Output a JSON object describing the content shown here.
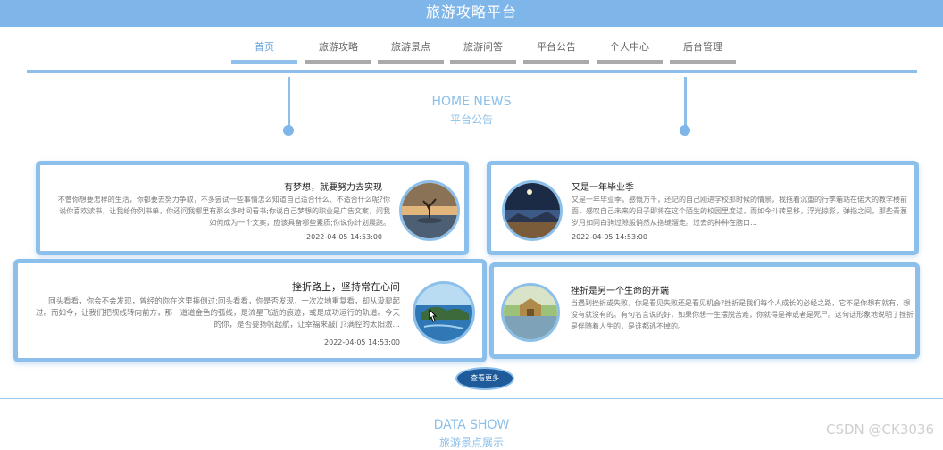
{
  "header": {
    "title": "旅游攻略平台"
  },
  "nav": {
    "items": [
      {
        "label": "首页",
        "active": true
      },
      {
        "label": "旅游攻略",
        "active": false
      },
      {
        "label": "旅游景点",
        "active": false
      },
      {
        "label": "旅游问答",
        "active": false
      },
      {
        "label": "平台公告",
        "active": false
      },
      {
        "label": "个人中心",
        "active": false
      },
      {
        "label": "后台管理",
        "active": false
      }
    ]
  },
  "news_section": {
    "title_en": "HOME NEWS",
    "title_cn": "平台公告"
  },
  "cards": [
    {
      "title": "有梦想，就要努力去实现",
      "body": "不管你想要怎样的生活，你都要去努力争取，不多尝试一些事情怎么知道自己适合什么、不适合什么呢?你说你喜欢读书，让我给你列书单，你还问我哪里有那么多时间看书;你说自己梦想的职业是广告文案，问我如何成为一个文案，应该具备哪些素质;你说你计划晨跑。",
      "date": "2022-04-05 14:53:00",
      "image": "lake-tree-sunset"
    },
    {
      "title": "又是一年毕业季",
      "body": "又是一年毕业季，感慨万千，还记的自己刚进学校那时候的情景，我拖着沉重的行李箱站在偌大的教学楼前面，感叹自己未来的日子即将在这个陌生的校园里度过，而如今斗转星移，浮光掠影，弹指之间，那些青葱岁月如同白驹过隙般悄然从指缝溜走。过去的种种在脑口…",
      "date": "2022-04-05 14:53:00",
      "image": "night-sky-coast"
    },
    {
      "title": "挫折路上，坚持常在心间",
      "body": "回头看看，你会不会发现，曾经的你在这里摔倒过;回头看看，你是否发现，一次次地重复看，却从没爬起过。而如今，让我们把视线转向前方，那一道道金色的弧线，是流星飞逝的痕迹，或是成功运行的轨道。今天的你，是否要扬帆起航，让幸福来敲门?满腔的太阳激…",
      "date": "2022-04-05 14:53:00",
      "image": "island-sea"
    },
    {
      "title": "挫折是另一个生命的开端",
      "body": "当遇到挫折或失败，你是看见失败还是看见机会?挫折是我们每个人成长的必经之路，它不是你想有就有，想没有就没有的。有句名言说的好，如果你想一生摆脱苦难，你就得是神或者是死尸。这句话形象地说明了挫折是伴随着人生的，是谁都逃不掉的。",
      "date": "",
      "image": "lake-temple"
    }
  ],
  "more_button": {
    "label": "查看更多"
  },
  "data_section": {
    "title_en": "DATA SHOW",
    "title_cn": "旅游景点展示"
  },
  "watermark": "CSDN @CK3036",
  "colors": {
    "accent": "#8cc0ea",
    "header": "#7fb6ea",
    "button": "#1f5a9a"
  }
}
